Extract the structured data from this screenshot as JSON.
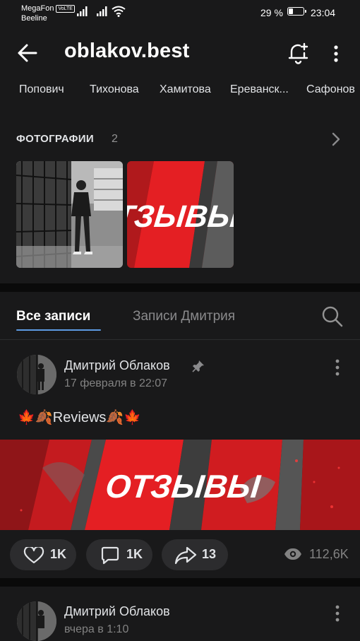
{
  "status_bar": {
    "carrier1": "MegaFon",
    "volte": "VoLTE",
    "carrier2": "Beeline",
    "battery": "29 %",
    "battery_level": 0.29,
    "time": "23:04"
  },
  "header": {
    "title": "oblakov.best",
    "back_icon": "arrow-left-icon",
    "bell_icon": "bell-plus-icon",
    "menu_icon": "more-vertical-icon"
  },
  "friends": [
    "Попович",
    "Тихонова",
    "Хамитова",
    "Ереванск...",
    "Сафонов"
  ],
  "photos": {
    "label": "ФОТОГРАФИИ",
    "count": "2",
    "banner_text": "ОТЗЫВЫ"
  },
  "tabs": {
    "all": "Все записи",
    "owner": "Записи Дмитрия"
  },
  "posts": [
    {
      "author": "Дмитрий Облаков",
      "date": "17 февраля в 22:07",
      "text": "🍁🍂Reviews🍂🍁",
      "image_text": "ОТЗЫВЫ",
      "likes": "1K",
      "comments": "1K",
      "shares": "13",
      "views": "112,6K"
    },
    {
      "author": "Дмитрий Облаков",
      "date": "вчера в 1:10"
    }
  ],
  "colors": {
    "background": "#19191a",
    "separator": "#0a0a0a",
    "accent": "#5d9be3",
    "banner_red": "#e41f23"
  }
}
